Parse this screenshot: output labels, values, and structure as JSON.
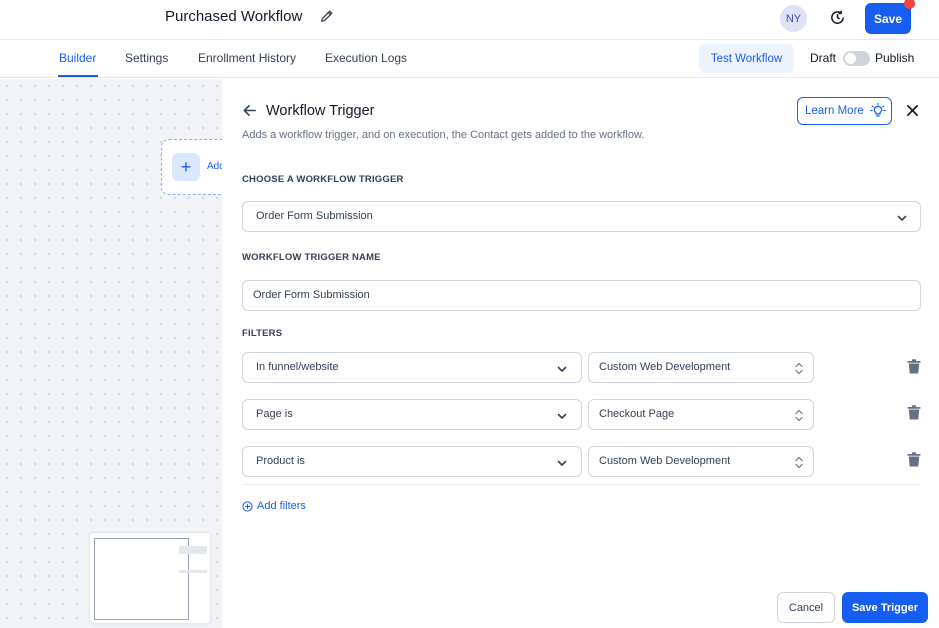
{
  "header": {
    "workflow_title": "Purchased Workflow",
    "avatar_initials": "NY",
    "save_label": "Save"
  },
  "tabs": [
    {
      "label": "Builder",
      "active": true
    },
    {
      "label": "Settings",
      "active": false
    },
    {
      "label": "Enrollment History",
      "active": false
    },
    {
      "label": "Execution Logs",
      "active": false
    }
  ],
  "toolbar": {
    "test_label": "Test Workflow",
    "draft_label": "Draft",
    "publish_label": "Publish",
    "publish_on": false
  },
  "canvas": {
    "add_node_label": "Add"
  },
  "panel": {
    "title": "Workflow Trigger",
    "description": "Adds a workflow trigger, and on execution, the Contact gets added to the workflow.",
    "learn_more_label": "Learn More",
    "choose_label": "CHOOSE A WORKFLOW TRIGGER",
    "trigger_selected": "Order Form Submission",
    "name_label": "WORKFLOW TRIGGER NAME",
    "name_value": "Order Form Submission",
    "filters_label": "FILTERS",
    "filters": [
      {
        "field": "In funnel/website",
        "value": "Custom Web Development"
      },
      {
        "field": "Page is",
        "value": "Checkout Page"
      },
      {
        "field": "Product is",
        "value": "Custom Web Development"
      }
    ],
    "add_filters_label": "Add filters",
    "cancel_label": "Cancel",
    "save_trigger_label": "Save Trigger"
  },
  "colors": {
    "primary": "#155eef",
    "primary_light": "#eef4ff",
    "danger_dot": "#f04438",
    "border": "#d0d5dd",
    "muted_text": "#667085"
  },
  "icons": [
    "edit-icon",
    "history-icon",
    "back-arrow-icon",
    "lightbulb-icon",
    "close-icon",
    "chevron-down-icon",
    "updown-chevron-icon",
    "trash-icon",
    "plus-circle-icon",
    "plus-icon"
  ]
}
